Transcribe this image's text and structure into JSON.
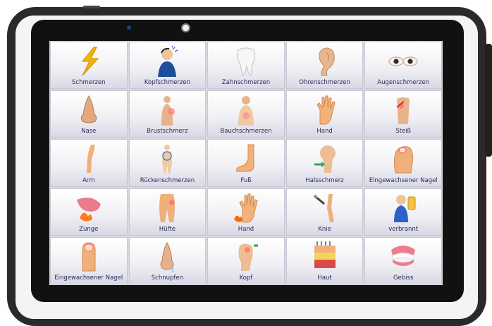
{
  "app": {
    "tiles": [
      {
        "label": "Schmerzen",
        "icon": "lightning-bolt-icon"
      },
      {
        "label": "Kopfschmerzen",
        "icon": "headache-person-icon"
      },
      {
        "label": "Zahnschmerzen",
        "icon": "tooth-icon"
      },
      {
        "label": "Ohrenschmerzen",
        "icon": "ear-icon"
      },
      {
        "label": "Augenschmerzen",
        "icon": "eyes-icon"
      },
      {
        "label": "Nase",
        "icon": "nose-icon"
      },
      {
        "label": "Brustschmerz",
        "icon": "chest-pain-icon"
      },
      {
        "label": "Bauchschmerzen",
        "icon": "stomach-pain-icon"
      },
      {
        "label": "Hand",
        "icon": "hand-icon"
      },
      {
        "label": "Steiß",
        "icon": "tailbone-icon"
      },
      {
        "label": "Arm",
        "icon": "arm-icon"
      },
      {
        "label": "Rückenschmerzen",
        "icon": "back-pain-icon"
      },
      {
        "label": "Fuß",
        "icon": "foot-icon"
      },
      {
        "label": "Halsschmerz",
        "icon": "throat-pain-icon"
      },
      {
        "label": "Eingewachsener Nagel",
        "icon": "toenail-icon"
      },
      {
        "label": "Zunge",
        "icon": "tongue-icon"
      },
      {
        "label": "Hüfte",
        "icon": "hip-icon"
      },
      {
        "label": "Hand",
        "icon": "burned-hand-icon"
      },
      {
        "label": "Knie",
        "icon": "knee-icon"
      },
      {
        "label": "verbrannt",
        "icon": "burned-person-icon"
      },
      {
        "label": "Eingewachsener Nagel",
        "icon": "fingernail-icon"
      },
      {
        "label": "Schnupfen",
        "icon": "runny-nose-icon"
      },
      {
        "label": "Kopf",
        "icon": "head-icon"
      },
      {
        "label": "Haut",
        "icon": "skin-layers-icon"
      },
      {
        "label": "Gebiss",
        "icon": "dentures-icon"
      }
    ]
  }
}
